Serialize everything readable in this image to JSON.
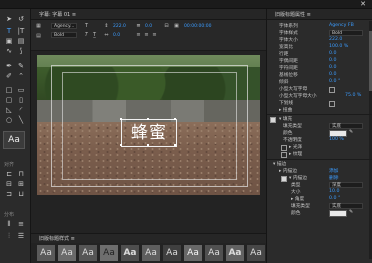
{
  "window": {
    "close_glyph": "✕"
  },
  "left_panel": {
    "aa_label": "Aa",
    "section_labels": [
      "对齐",
      "分布"
    ]
  },
  "editor_tab": {
    "label": "字幕: 字幕 01 ≡"
  },
  "toolbar": {
    "font_family": "Agency...",
    "font_style": "Bold",
    "size_value": "222.0",
    "kerning_value": "0.0",
    "leading_value": "0.0",
    "timecode": "00:00:00:00"
  },
  "caption": {
    "text": "蜂蜜"
  },
  "styles_panel": {
    "tab_label": "旧版标题样式 ≡",
    "samples": [
      "Aa",
      "Aa",
      "Aa",
      "Aa",
      "Aa",
      "Aa",
      "Aa",
      "Aa",
      "Aa",
      "Aa",
      "Aa"
    ]
  },
  "properties": {
    "header": "旧版标题属性 ≡",
    "rows": [
      {
        "label": "字体系列",
        "value": "Agency FB"
      },
      {
        "label": "字体样式",
        "value": "Bold",
        "dropdown": true
      },
      {
        "label": "字体大小",
        "value": "222.0"
      },
      {
        "label": "宽高比",
        "value": "100.0 %"
      },
      {
        "label": "行距",
        "value": "0.0"
      },
      {
        "label": "字偶间距",
        "value": "0.0"
      },
      {
        "label": "字符间距",
        "value": "0.0"
      },
      {
        "label": "基线位移",
        "value": "0.0"
      },
      {
        "label": "倾斜",
        "value": "0.0 °"
      },
      {
        "label": "小型大写字母",
        "value": ""
      },
      {
        "label": "小型大写字母大小",
        "value": "75.0 %"
      },
      {
        "label": "下划线",
        "value": ""
      },
      {
        "label": "▸ 扭曲",
        "value": ""
      },
      {
        "label": "▾ 填充",
        "value": ""
      },
      {
        "label": "填充类型",
        "value": "实底",
        "dropdown": true
      },
      {
        "label": "颜色",
        "value": ""
      },
      {
        "label": "不透明度",
        "value": "100 %"
      },
      {
        "label": "▸ 光泽",
        "value": ""
      },
      {
        "label": "▸ 纹理",
        "value": ""
      },
      {
        "label": "▾ 描边",
        "value": ""
      },
      {
        "label": "▸ 内描边",
        "value": "添加"
      },
      {
        "label": "▾ 内描边",
        "value": "删除"
      },
      {
        "label": "类型",
        "value": "深度",
        "dropdown": true
      },
      {
        "label": "大小",
        "value": "10.0"
      },
      {
        "label": "▸ 角度",
        "value": "0.0 °"
      },
      {
        "label": "填充类型",
        "value": "实底",
        "dropdown": true
      },
      {
        "label": "颜色",
        "value": ""
      }
    ]
  },
  "colors": {
    "accent": "#3b9cff",
    "fill_color": "#e8e8e8",
    "stroke_color": "#e8e8e8"
  }
}
